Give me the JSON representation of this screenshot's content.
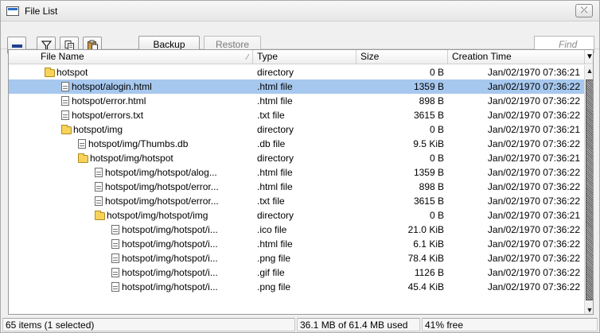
{
  "window": {
    "title": "File List",
    "close_label": "⤫"
  },
  "toolbar": {
    "backup_label": "Backup",
    "restore_label": "Restore",
    "find_placeholder": "Find"
  },
  "table": {
    "columns": {
      "name": "File Name",
      "type": "Type",
      "size": "Size",
      "time": "Creation Time"
    },
    "rows": [
      {
        "name": "hotspot",
        "icon": "folder",
        "indent": 0,
        "type": "directory",
        "size": "0 B",
        "time": "Jan/02/1970 07:36:21",
        "selected": false
      },
      {
        "name": "hotspot/alogin.html",
        "icon": "file",
        "indent": 1,
        "type": ".html file",
        "size": "1359 B",
        "time": "Jan/02/1970 07:36:22",
        "selected": true
      },
      {
        "name": "hotspot/error.html",
        "icon": "file",
        "indent": 1,
        "type": ".html file",
        "size": "898 B",
        "time": "Jan/02/1970 07:36:22",
        "selected": false
      },
      {
        "name": "hotspot/errors.txt",
        "icon": "file",
        "indent": 1,
        "type": ".txt file",
        "size": "3615 B",
        "time": "Jan/02/1970 07:36:22",
        "selected": false
      },
      {
        "name": "hotspot/img",
        "icon": "folder",
        "indent": 1,
        "type": "directory",
        "size": "0 B",
        "time": "Jan/02/1970 07:36:21",
        "selected": false
      },
      {
        "name": "hotspot/img/Thumbs.db",
        "icon": "file",
        "indent": 2,
        "type": ".db file",
        "size": "9.5 KiB",
        "time": "Jan/02/1970 07:36:22",
        "selected": false
      },
      {
        "name": "hotspot/img/hotspot",
        "icon": "folder",
        "indent": 2,
        "type": "directory",
        "size": "0 B",
        "time": "Jan/02/1970 07:36:21",
        "selected": false
      },
      {
        "name": "hotspot/img/hotspot/alog...",
        "icon": "file",
        "indent": 3,
        "type": ".html file",
        "size": "1359 B",
        "time": "Jan/02/1970 07:36:22",
        "selected": false
      },
      {
        "name": "hotspot/img/hotspot/error...",
        "icon": "file",
        "indent": 3,
        "type": ".html file",
        "size": "898 B",
        "time": "Jan/02/1970 07:36:22",
        "selected": false
      },
      {
        "name": "hotspot/img/hotspot/error...",
        "icon": "file",
        "indent": 3,
        "type": ".txt file",
        "size": "3615 B",
        "time": "Jan/02/1970 07:36:22",
        "selected": false
      },
      {
        "name": "hotspot/img/hotspot/img",
        "icon": "folder",
        "indent": 3,
        "type": "directory",
        "size": "0 B",
        "time": "Jan/02/1970 07:36:21",
        "selected": false
      },
      {
        "name": "hotspot/img/hotspot/i...",
        "icon": "file",
        "indent": 4,
        "type": ".ico file",
        "size": "21.0 KiB",
        "time": "Jan/02/1970 07:36:22",
        "selected": false
      },
      {
        "name": "hotspot/img/hotspot/i...",
        "icon": "file",
        "indent": 4,
        "type": ".html file",
        "size": "6.1 KiB",
        "time": "Jan/02/1970 07:36:22",
        "selected": false
      },
      {
        "name": "hotspot/img/hotspot/i...",
        "icon": "file",
        "indent": 4,
        "type": ".png file",
        "size": "78.4 KiB",
        "time": "Jan/02/1970 07:36:22",
        "selected": false
      },
      {
        "name": "hotspot/img/hotspot/i...",
        "icon": "file",
        "indent": 4,
        "type": ".gif file",
        "size": "1126 B",
        "time": "Jan/02/1970 07:36:22",
        "selected": false
      },
      {
        "name": "hotspot/img/hotspot/i...",
        "icon": "file",
        "indent": 4,
        "type": ".png file",
        "size": "45.4 KiB",
        "time": "Jan/02/1970 07:36:22",
        "selected": false
      }
    ]
  },
  "status": {
    "items_text": "65 items (1 selected)",
    "used_text": "36.1 MB of 61.4 MB used",
    "free_text": "41% free"
  },
  "colors": {
    "selected_row": "#a7c8ee",
    "folder": "#f7d35a"
  }
}
